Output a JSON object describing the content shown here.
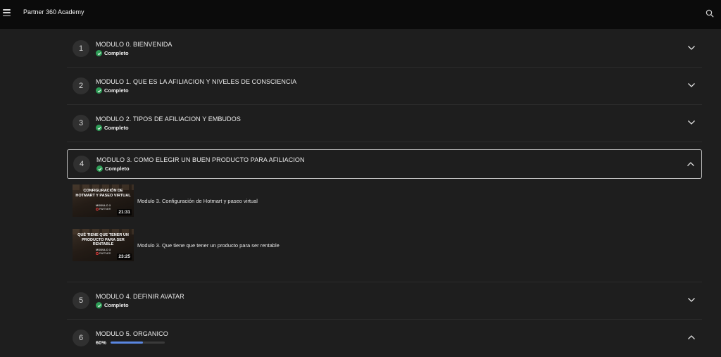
{
  "header": {
    "title": "Partner 360 Academy",
    "menu_icon": "hamburger-icon",
    "search_icon": "search-icon"
  },
  "modules": [
    {
      "number": "1",
      "title": "MODULO 0. BIENVENIDA",
      "status": "Completo",
      "expanded": false
    },
    {
      "number": "2",
      "title": "MODULO 1. QUE ES LA AFILIACION Y NIVELES DE CONSCIENCIA",
      "status": "Completo",
      "expanded": false
    },
    {
      "number": "3",
      "title": "MODULO 2. TIPOS DE AFILIACION Y EMBUDOS",
      "status": "Completo",
      "expanded": false
    },
    {
      "number": "4",
      "title": "MODULO 3. COMO ELEGIR UN BUEN PRODUCTO PARA AFILIACION",
      "status": "Completo",
      "expanded": true
    },
    {
      "number": "5",
      "title": "MODULO 4. DEFINIR AVATAR",
      "status": "Completo",
      "expanded": false
    },
    {
      "number": "6",
      "title": "MODULO 5. ORGANICO",
      "progress_label": "60%",
      "progress": 0.6,
      "expanded": true
    }
  ],
  "lessons": [
    {
      "title": "Modulo 3. Configuración de Hotmart y paseo virtual",
      "thumb_text": "CONFIGURACIÓN DE HOTMART Y PASEO VIRTUAL",
      "thumb_sub": "MODULO 3",
      "thumb_logo": "PARTNER",
      "duration": "21:31"
    },
    {
      "title": "Modulo 3. Que tiene que tener un producto para ser rentable",
      "thumb_text": "QUÉ TIENE QUE TENER UN PRODUCTO PARA SER RENTABLE",
      "thumb_sub": "MODULO 3",
      "thumb_logo": "PARTNER",
      "duration": "23:25"
    }
  ],
  "colors": {
    "topbar": "#0b0b0b",
    "background": "#1e1e1e",
    "complete_check": "#2e9e57",
    "progress_fill": "#5a86e0"
  }
}
